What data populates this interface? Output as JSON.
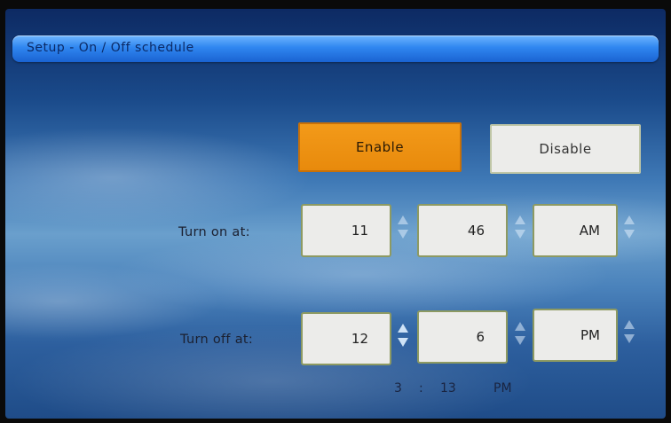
{
  "window": {
    "title": "Setup - On / Off schedule"
  },
  "status": {
    "enable_label": "Enable",
    "disable_label": "Disable",
    "selected": "Enable"
  },
  "turn_on": {
    "label": "Turn on at:",
    "hour": "11",
    "minute": "46",
    "period": "AM"
  },
  "turn_off": {
    "label": "Turn off at:",
    "hour": "12",
    "minute": "6",
    "period": "PM"
  },
  "current_time": {
    "hour": "3",
    "separator": ":",
    "minute": "13",
    "period": "PM"
  },
  "colors": {
    "selected_button": "#e88a0c",
    "title_bar": "#2f86f0",
    "field_border": "#8d9a62"
  }
}
